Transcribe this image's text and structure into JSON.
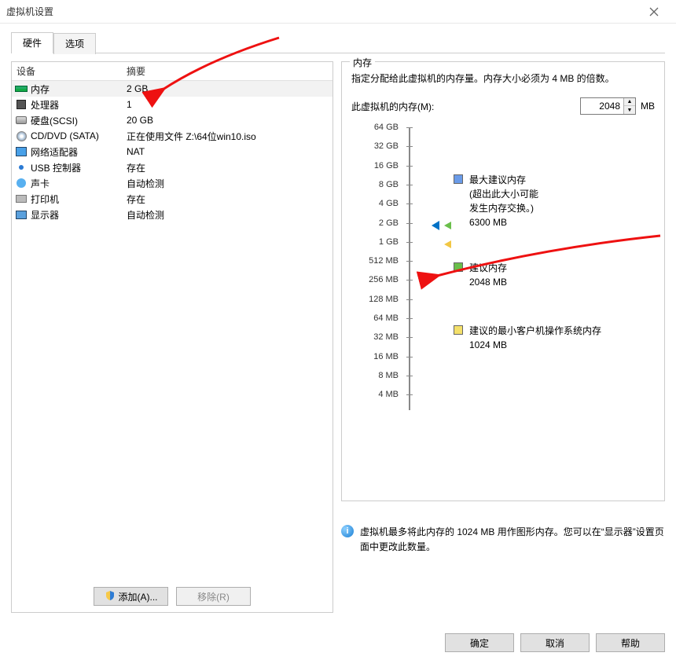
{
  "window": {
    "title": "虚拟机设置"
  },
  "tabs": {
    "hardware": "硬件",
    "options": "选项"
  },
  "hw_header": {
    "device": "设备",
    "summary": "摘要"
  },
  "hw": [
    {
      "name": "内存",
      "summary": "2 GB",
      "icon": "mem"
    },
    {
      "name": "处理器",
      "summary": "1",
      "icon": "cpu"
    },
    {
      "name": "硬盘(SCSI)",
      "summary": "20 GB",
      "icon": "hdd"
    },
    {
      "name": "CD/DVD (SATA)",
      "summary": "正在使用文件 Z:\\64位win10.iso",
      "icon": "cd"
    },
    {
      "name": "网络适配器",
      "summary": "NAT",
      "icon": "net"
    },
    {
      "name": "USB 控制器",
      "summary": "存在",
      "icon": "usb"
    },
    {
      "name": "声卡",
      "summary": "自动检测",
      "icon": "snd"
    },
    {
      "name": "打印机",
      "summary": "存在",
      "icon": "prn"
    },
    {
      "name": "显示器",
      "summary": "自动检测",
      "icon": "disp"
    }
  ],
  "left_buttons": {
    "add": "添加(A)...",
    "remove": "移除(R)"
  },
  "mem": {
    "group_title": "内存",
    "desc": "指定分配给此虚拟机的内存量。内存大小必须为 4 MB 的倍数。",
    "label": "此虚拟机的内存(M):",
    "value": "2048",
    "unit": "MB",
    "ticks": [
      "64 GB",
      "32 GB",
      "16 GB",
      "8 GB",
      "4 GB",
      "2 GB",
      "1 GB",
      "512 MB",
      "256 MB",
      "128 MB",
      "64 MB",
      "32 MB",
      "16 MB",
      "8 MB",
      "4 MB"
    ],
    "legend": {
      "max_title": "最大建议内存",
      "max_note1": "(超出此大小可能",
      "max_note2": "发生内存交换。)",
      "max_val": "6300 MB",
      "rec_title": "建议内存",
      "rec_val": "2048 MB",
      "min_title": "建议的最小客户机操作系统内存",
      "min_val": "1024 MB"
    },
    "info": "虚拟机最多将此内存的 1024 MB 用作图形内存。您可以在“显示器”设置页面中更改此数量。"
  },
  "footer": {
    "ok": "确定",
    "cancel": "取消",
    "help": "帮助"
  }
}
